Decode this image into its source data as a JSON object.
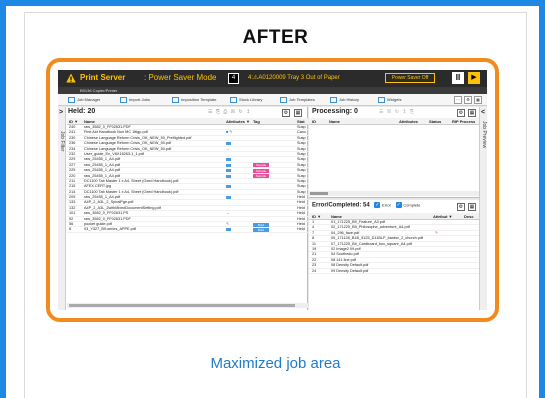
{
  "header": {
    "title": "AFTER"
  },
  "caption": "Maximized job area",
  "statusbar": {
    "title": "Print Server",
    "mode": ": Power Saver Mode",
    "count": "4",
    "message": "4:⚠A0120009 Tray 3 Out of Paper",
    "power_saver_button": "Power Saver Off",
    "pause_glyph": "II",
    "play_glyph": "▶"
  },
  "device": {
    "name": "B9136 Copier/Printer"
  },
  "toolbar": {
    "tabs": [
      {
        "label": "Job Manager"
      },
      {
        "label": "Import Jobs"
      },
      {
        "label": "Imposition Template"
      },
      {
        "label": "Stock Library"
      },
      {
        "label": "Job Templates"
      },
      {
        "label": "Job History"
      },
      {
        "label": "Widgets"
      }
    ],
    "more_glyph": "···",
    "settings_glyph": "⚙",
    "grid_glyph": "▦"
  },
  "job_filter": {
    "chevron": ">",
    "label": "Job Filter"
  },
  "job_preview": {
    "chevron": "<",
    "label": "Job Preview"
  },
  "held": {
    "title": "Held: 20",
    "tools": "☰ ⎘ ⎙ ☒ ↻ ↥",
    "settings_glyph": "⚙",
    "grid_glyph": "▦",
    "columns": {
      "id": "ID ▼",
      "name": "Name",
      "attributes": "Attributes ▼",
      "tag": "Tag",
      "status": "Stat"
    },
    "rows": [
      {
        "id": "240",
        "name": "raw_3582_0_FF02631.PDF",
        "attr": "",
        "tag": "",
        "status": "Susp"
      },
      {
        "id": "241",
        "name": "First Aid Handbook Non MC 1ttigp.pdf",
        "attr": "icons",
        "tag": "",
        "status": "Canc"
      },
      {
        "id": "230",
        "name": "Chinese Language Reform Crisis_OK_NEW_50_Preflighted.pdf",
        "attr": "",
        "tag": "",
        "status": "Susp"
      },
      {
        "id": "236",
        "name": "Chinese Language Reform Crisis_OK_NEW_50.pdf",
        "attr": "blue",
        "tag": "",
        "status": "Susp"
      },
      {
        "id": "234",
        "name": "Chinese Language Reform Crisis_OK_NEW_50.pdf",
        "attr": "arrow",
        "tag": "",
        "status": "Susp"
      },
      {
        "id": "232",
        "name": "User_guide_En_V6X16263-1_1.pdf",
        "attr": "",
        "tag": "",
        "status": "Susp"
      },
      {
        "id": "229",
        "name": "raw_25455_1_A4.pdf",
        "attr": "blue",
        "tag": "",
        "status": "Susp"
      },
      {
        "id": "227",
        "name": "raw_25455_1_A4.pdf",
        "attr": "blue",
        "tag": "Sample",
        "status": "Susp"
      },
      {
        "id": "225",
        "name": "raw_25455_1_A4.pdf",
        "attr": "blue",
        "tag": "Sample",
        "status": "Susp"
      },
      {
        "id": "220",
        "name": "raw_25455_1_A4.pdf",
        "attr": "blue",
        "tag": "Sample",
        "status": "Susp"
      },
      {
        "id": "211",
        "name": "DC1100 Tab Master 1 x A4, Sheet (Oxed Handbook).pdf",
        "attr": "",
        "tag": "",
        "status": "Susp"
      },
      {
        "id": "215",
        "name": "AFEX CERT.jpg",
        "attr": "blue",
        "tag": "",
        "status": "Susp"
      },
      {
        "id": "214",
        "name": "DC1100 Tab Master 1 x A4, Sheet (Oxed Handbook).pdf",
        "attr": "",
        "tag": "",
        "status": "Susp"
      },
      {
        "id": "209",
        "name": "raw_25455_1_A4.pdf",
        "attr": "blue",
        "tag": "",
        "status": "Held"
      },
      {
        "id": "133",
        "name": "A4P_2_A3L_2_SpiralPge.pdf",
        "attr": "",
        "tag": "",
        "status": "Held"
      },
      {
        "id": "132",
        "name": "A4P_2_A3L_2withMixedDocumentSetting.pdf",
        "attr": "",
        "tag": "",
        "status": "Held"
      },
      {
        "id": "101",
        "name": "raw_3582_0_FF02631 PS",
        "attr": "arrow",
        "tag": "",
        "status": "Held"
      },
      {
        "id": "92",
        "name": "raw_3582_0_FF02631.PDF",
        "attr": "",
        "tag": "",
        "status": "Held"
      },
      {
        "id": "56",
        "name": "pocket guide.pdf",
        "attr": "pen",
        "tag": "Bold",
        "status": "Held"
      },
      {
        "id": "6",
        "name": "03_Y327_B9-series_APPE.pdf",
        "attr": "blue",
        "tag": "Bold",
        "status": "Held"
      }
    ]
  },
  "processing": {
    "title": "Processing: 0",
    "tools": "☰ ☒ ↻ ↥ ⎘",
    "settings_glyph": "⚙",
    "grid_glyph": "▦",
    "columns": {
      "id": "ID",
      "name": "Name",
      "attributes": "Attributes",
      "status": "Status",
      "rip": "RIP Process"
    }
  },
  "error_completed": {
    "title": "Error/Completed: 54",
    "error_label": "Error",
    "completed_label": "Complete",
    "check_glyph": "✓",
    "settings_glyph": "⚙",
    "grid_glyph": "▦",
    "columns": {
      "id": "ID ▼",
      "name": "Name",
      "attributes": "Attribut ▼",
      "desc": "Desc"
    },
    "rows": [
      {
        "id": "1",
        "name": "01_171225_B9_Feature_A3.pdf",
        "attr": "blue"
      },
      {
        "id": "4",
        "name": "02_171225_B9_Philosophe_adventure_A4.pdf",
        "attr": ""
      },
      {
        "id": "7",
        "name": "04_296_face.pdf",
        "attr": "pen"
      },
      {
        "id": "8",
        "name": "05_171128_B1B_9125_D11BLP_bardsc_2_church.pdf",
        "attr": ""
      },
      {
        "id": "11",
        "name": "07_171225_B9_Cardboard_box_square_A4.pdf",
        "attr": ""
      },
      {
        "id": "19",
        "name": "02 Image2 09.pdf",
        "attr": ""
      },
      {
        "id": "21",
        "name": "04 Southedo.pdf",
        "attr": ""
      },
      {
        "id": "22",
        "name": "08 141 line.pdf",
        "attr": ""
      },
      {
        "id": "23",
        "name": "08 Density Default.pdf",
        "attr": ""
      },
      {
        "id": "24",
        "name": "09 Density Default.pdf",
        "attr": ""
      }
    ]
  }
}
